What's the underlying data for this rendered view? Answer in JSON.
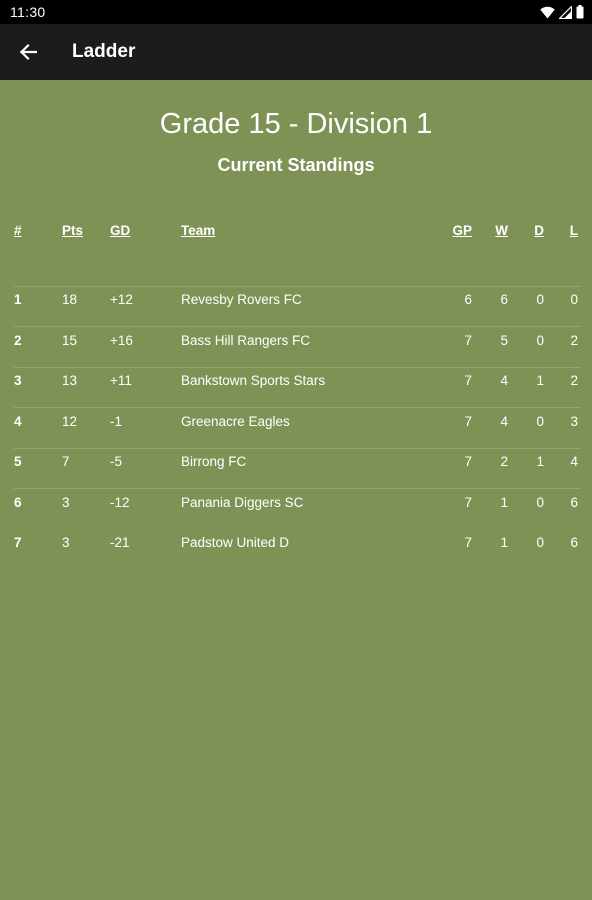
{
  "status_bar": {
    "time": "11:30",
    "icons": [
      "wifi-icon",
      "signal-icon",
      "battery-icon"
    ]
  },
  "app_bar": {
    "back_icon": "arrow-left-icon",
    "title": "Ladder"
  },
  "competition": {
    "title": "Grade 15 - Division 1",
    "subtitle": "Current Standings"
  },
  "ladder": {
    "columns": {
      "pos": "#",
      "pts": "Pts",
      "gd": "GD",
      "team": "Team",
      "gp": "GP",
      "w": "W",
      "d": "D",
      "l": "L"
    },
    "rows": [
      {
        "pos": "1",
        "pts": "18",
        "gd": "+12",
        "team": "Revesby Rovers FC",
        "gp": "6",
        "w": "6",
        "d": "0",
        "l": "0"
      },
      {
        "pos": "2",
        "pts": "15",
        "gd": "+16",
        "team": "Bass Hill Rangers FC",
        "gp": "7",
        "w": "5",
        "d": "0",
        "l": "2"
      },
      {
        "pos": "3",
        "pts": "13",
        "gd": "+11",
        "team": "Bankstown Sports Stars",
        "gp": "7",
        "w": "4",
        "d": "1",
        "l": "2"
      },
      {
        "pos": "4",
        "pts": "12",
        "gd": "-1",
        "team": "Greenacre Eagles",
        "gp": "7",
        "w": "4",
        "d": "0",
        "l": "3"
      },
      {
        "pos": "5",
        "pts": "7",
        "gd": "-5",
        "team": "Birrong FC",
        "gp": "7",
        "w": "2",
        "d": "1",
        "l": "4"
      },
      {
        "pos": "6",
        "pts": "3",
        "gd": "-12",
        "team": "Panania Diggers SC",
        "gp": "7",
        "w": "1",
        "d": "0",
        "l": "6"
      },
      {
        "pos": "7",
        "pts": "3",
        "gd": "-21",
        "team": "Padstow United D",
        "gp": "7",
        "w": "1",
        "d": "0",
        "l": "6"
      }
    ]
  },
  "colors": {
    "background": "#7f9256",
    "app_bar": "#1c1c1e",
    "status_bar": "#000000",
    "text": "#ffffff"
  }
}
